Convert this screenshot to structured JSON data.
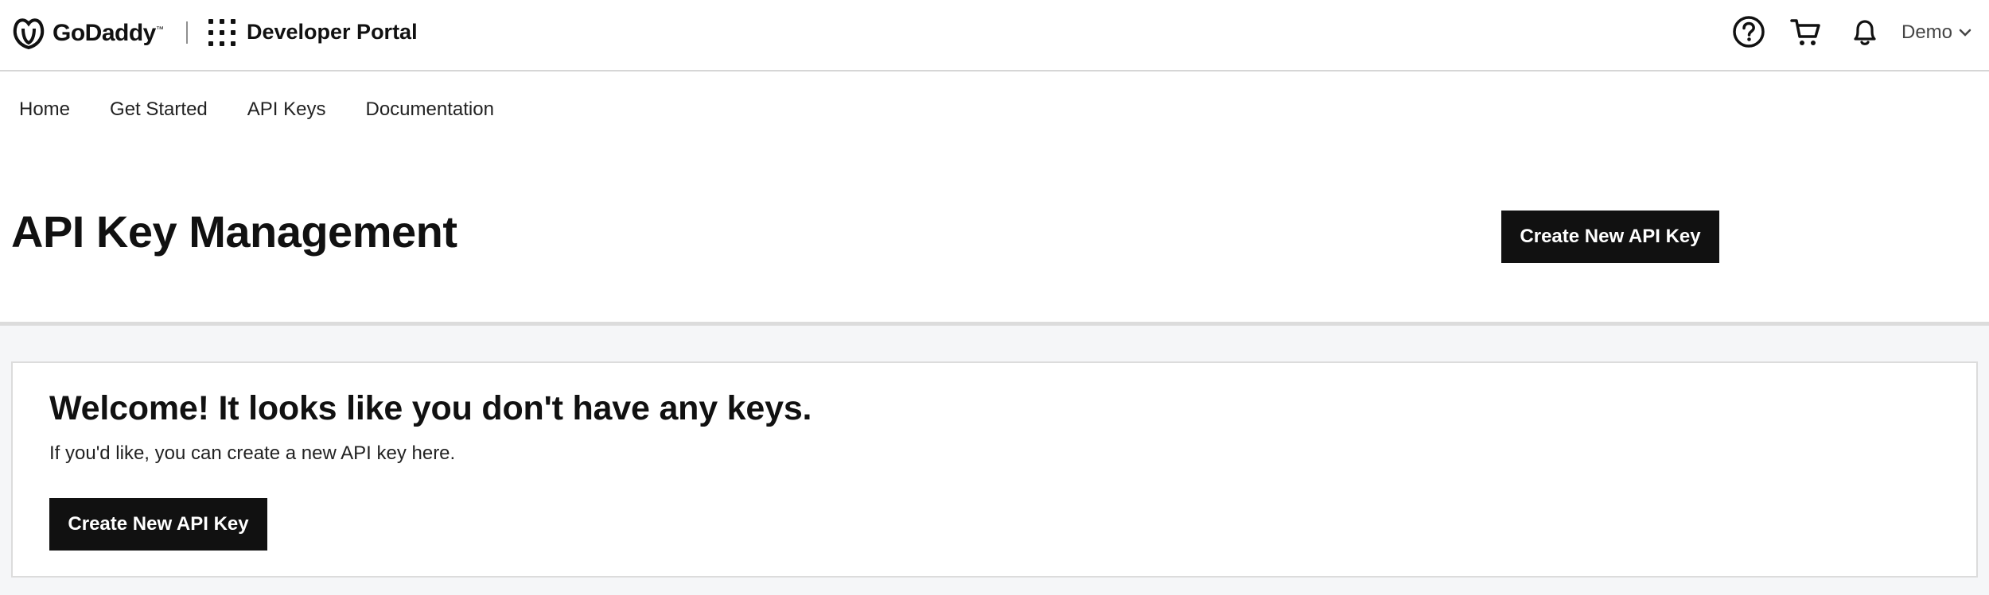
{
  "header": {
    "brand": "GoDaddy",
    "brand_mark": "™",
    "portal_title": "Developer Portal",
    "icons": [
      "help-icon",
      "cart-icon",
      "bell-icon"
    ],
    "account_label": "Demo"
  },
  "nav": {
    "items": [
      {
        "label": "Home"
      },
      {
        "label": "Get Started"
      },
      {
        "label": "API Keys"
      },
      {
        "label": "Documentation"
      }
    ]
  },
  "page": {
    "title": "API Key Management",
    "create_button": "Create New API Key"
  },
  "empty_state": {
    "title": "Welcome! It looks like you don't have any keys.",
    "text": "If you'd like, you can create a new API key here.",
    "create_button": "Create New API Key"
  },
  "colors": {
    "button_bg": "#111111",
    "button_text": "#ffffff",
    "content_bg": "#f5f6f8",
    "border": "#dcdcdc"
  }
}
